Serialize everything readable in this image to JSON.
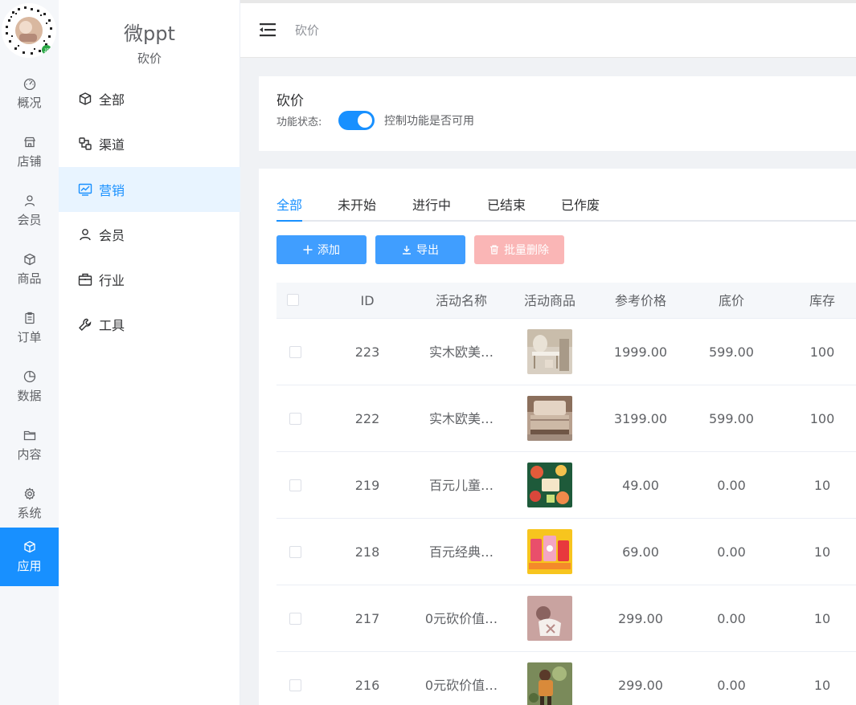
{
  "rail": {
    "items": [
      {
        "label": "概况",
        "icon": "dashboard-icon"
      },
      {
        "label": "店铺",
        "icon": "store-icon"
      },
      {
        "label": "会员",
        "icon": "user-icon"
      },
      {
        "label": "商品",
        "icon": "cube-icon"
      },
      {
        "label": "订单",
        "icon": "clipboard-icon"
      },
      {
        "label": "数据",
        "icon": "pie-icon"
      },
      {
        "label": "内容",
        "icon": "folder-icon"
      },
      {
        "label": "系统",
        "icon": "gear-icon"
      },
      {
        "label": "应用",
        "icon": "cube-icon",
        "active": true
      }
    ]
  },
  "sidebar": {
    "brand": "微ppt",
    "subtitle": "砍价",
    "items": [
      {
        "label": "全部",
        "icon": "cube-icon"
      },
      {
        "label": "渠道",
        "icon": "channel-icon"
      },
      {
        "label": "营销",
        "icon": "monitor-chart-icon",
        "active": true
      },
      {
        "label": "会员",
        "icon": "user-icon"
      },
      {
        "label": "行业",
        "icon": "briefcase-icon"
      },
      {
        "label": "工具",
        "icon": "wrench-icon"
      }
    ]
  },
  "header": {
    "title": "砍价"
  },
  "feature": {
    "title": "砍价",
    "switch_label": "功能状态:",
    "switch_on": true,
    "switch_hint": "控制功能是否可用"
  },
  "tabs": [
    "全部",
    "未开始",
    "进行中",
    "已结束",
    "已作废"
  ],
  "buttons": {
    "add": "添加",
    "export": "导出",
    "batch_delete": "批量删除"
  },
  "table": {
    "columns": [
      "ID",
      "活动名称",
      "活动商品",
      "参考价格",
      "底价",
      "库存"
    ],
    "rows": [
      {
        "id": "223",
        "name": "实木欧美…",
        "price": "1999.00",
        "floor": "599.00",
        "stock": "100"
      },
      {
        "id": "222",
        "name": "实木欧美…",
        "price": "3199.00",
        "floor": "599.00",
        "stock": "100"
      },
      {
        "id": "219",
        "name": "百元儿童…",
        "price": "49.00",
        "floor": "0.00",
        "stock": "10"
      },
      {
        "id": "218",
        "name": "百元经典…",
        "price": "69.00",
        "floor": "0.00",
        "stock": "10"
      },
      {
        "id": "217",
        "name": "0元砍价值…",
        "price": "299.00",
        "floor": "0.00",
        "stock": "10"
      },
      {
        "id": "216",
        "name": "0元砍价值…",
        "price": "299.00",
        "floor": "0.00",
        "stock": "10"
      }
    ]
  },
  "colors": {
    "primary": "#1890ff",
    "button": "#409eff",
    "danger_disabled": "#fab6b6"
  }
}
